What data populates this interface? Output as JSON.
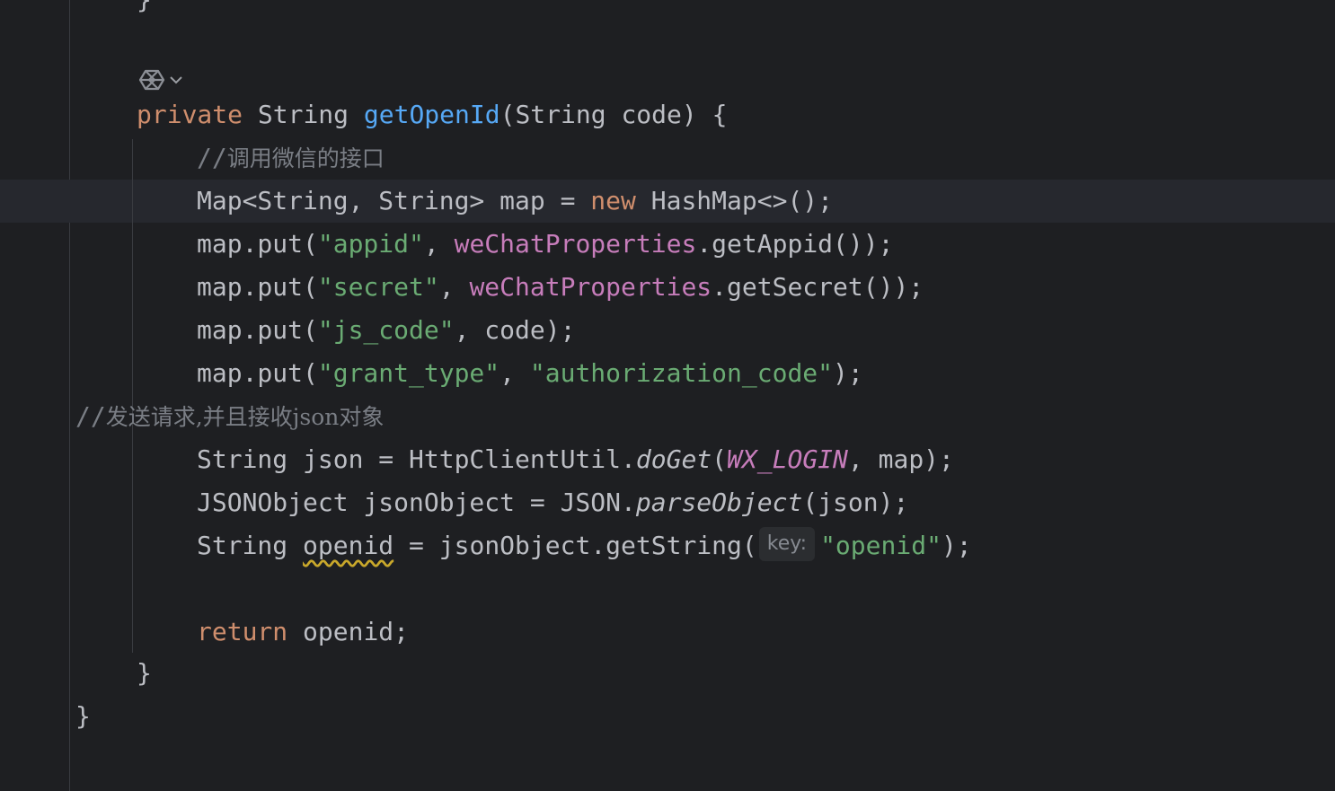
{
  "editor": {
    "top_brace": "}",
    "gutter_icon": "ai-assistant-icon",
    "gutter_chevron": "chevron-down-icon",
    "lines": {
      "method_sig": {
        "kw_private": "private",
        "type": " String ",
        "name": "getOpenId",
        "params": "(String code) {"
      },
      "comment1": {
        "slashes": "//",
        "text": "调用微信的接口"
      },
      "map_decl": {
        "a": "Map<String, String> map = ",
        "kw_new": "new",
        "b": " HashMap<>();"
      },
      "put_appid": {
        "a": "map.put(",
        "key": "\"appid\"",
        "b": ", ",
        "field": "weChatProperties",
        "c": ".getAppid());"
      },
      "put_secret": {
        "a": "map.put(",
        "key": "\"secret\"",
        "b": ", ",
        "field": "weChatProperties",
        "c": ".getSecret());"
      },
      "put_jscode": {
        "a": "map.put(",
        "key": "\"js_code\"",
        "b": ", code);"
      },
      "put_grant": {
        "a": "map.put(",
        "key": "\"grant_type\"",
        "b": ", ",
        "val": "\"authorization_code\"",
        "c": ");"
      },
      "comment2": {
        "slashes": "//",
        "text": "发送请求,并且接收json对象"
      },
      "json_decl": {
        "a": "String json = HttpClientUtil.",
        "method": "doGet",
        "b": "(",
        "const": "WX_LOGIN",
        "c": ", map);"
      },
      "jsonobj_decl": {
        "a": "JSONObject jsonObject = JSON.",
        "method": "parseObject",
        "b": "(json);"
      },
      "openid_decl": {
        "a": "String ",
        "var": "openid",
        "b": " = jsonObject.getString(",
        "hint": "key:",
        "str": "\"openid\"",
        "c": ");"
      },
      "return_stmt": {
        "kw_return": "return",
        "b": " openid;"
      },
      "close_method": "}",
      "close_class": "}"
    }
  }
}
